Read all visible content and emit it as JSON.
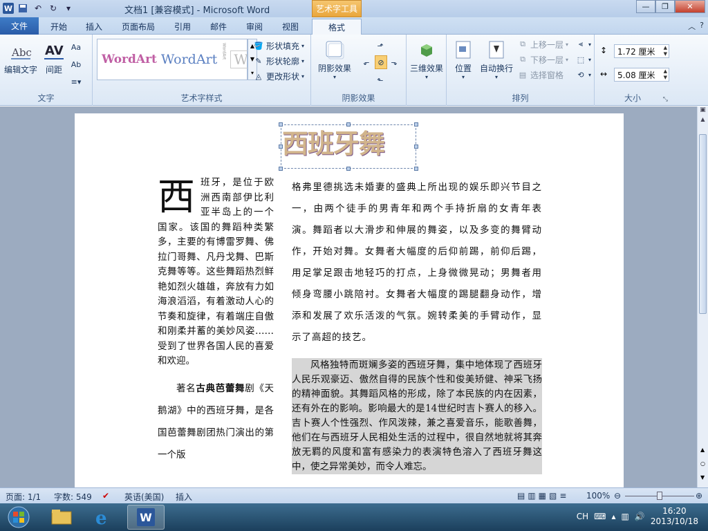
{
  "title_bar": {
    "doc_title": "文档1 [兼容模式] - Microsoft Word",
    "contextual_header": "艺术字工具"
  },
  "tabs": {
    "file": "文件",
    "items": [
      "开始",
      "插入",
      "页面布局",
      "引用",
      "邮件",
      "审阅",
      "视图"
    ],
    "contextual": "格式"
  },
  "ribbon": {
    "text_group": {
      "label": "文字",
      "edit_text": "编辑文字",
      "spacing": "间距"
    },
    "wordart_styles": {
      "label": "艺术字样式",
      "shape_fill": "形状填充",
      "shape_outline": "形状轮廓",
      "change_shape": "更改形状",
      "sample1": "WordArt",
      "sample2": "WordArt",
      "sample3": "WordArt",
      "sample4": "W"
    },
    "shadow": {
      "label": "阴影效果",
      "button": "阴影效果"
    },
    "threed": {
      "button": "三维效果"
    },
    "arrange": {
      "label": "排列",
      "position": "位置",
      "wrap": "自动换行",
      "bring_forward": "上移一层",
      "send_backward": "下移一层",
      "selection_pane": "选择窗格"
    },
    "size": {
      "label": "大小",
      "height": "1.72 厘米",
      "width": "5.08 厘米"
    }
  },
  "document": {
    "wordart_text": "西班牙舞",
    "left_col": {
      "dropcap": "西",
      "text": "班牙，是位于欧洲西南部伊比利亚半岛上的一个国家。该国的舞蹈种类繁多，主要的有博雷罗舞、佛拉门哥舞、凡丹戈舞、巴斯克舞等等。这些舞蹈热烈鲜艳如烈火雄雄，奔放有力如海浪滔滔，有着激动人心的节奏和旋律，有着端庄自傲和刚柔并蓄的美妙风姿……受到了世界各国人民的喜爱和欢迎。",
      "p2_before": "著名",
      "p2_bold": "古典芭蕾舞",
      "p2_after": "剧《天鹅湖》中的西班牙舞，是各国芭蕾舞剧团热门演出的第一个版"
    },
    "right_col": {
      "p1": "格弗里德挑选未婚妻的盛典上所出现的娱乐即兴节目之一，由两个徒手的男青年和两个手持折扇的女青年表演。舞蹈者以大滑步和伸展的舞姿，以及多变的舞臂动作，开始对舞。女舞者大幅度的后仰前踢，前仰后踢，用足掌足跟击地轻巧的打点，上身微微晃动；男舞者用倾身弯腰小跳陪衬。女舞者大幅度的踢腿翻身动作，增添和发展了欢乐活泼的气氛。婉转柔美的手臂动作，显示了高超的技艺。",
      "p2": "风格独特而斑斓多姿的西班牙舞，集中地体现了西班牙人民乐观豪迈、傲然自得的民族个性和俊美矫健、神采飞扬的精神面貌。其舞蹈风格的形成，除了本民族的内在因素，还有外在的影响。影响最大的是14世纪时吉卜赛人的移入。吉卜赛人个性强烈、作风泼辣，兼之喜爱音乐，能歌善舞，他们在与西班牙人民相处生活的过程中，很自然地就将其奔放无羁的风度和富有感染力的表演特色溶入了西班牙舞这中，使之异常美妙，而令人难忘。"
    }
  },
  "status_bar": {
    "page": "页面: 1/1",
    "words": "字数: 549",
    "language": "英语(美国)",
    "mode": "插入",
    "zoom": "100%"
  },
  "taskbar": {
    "lang": "CH",
    "time": "16:20",
    "date": "2013/10/18"
  },
  "colors": {
    "file_tab": "#2b579a",
    "context_orange": "#e9a63c"
  }
}
